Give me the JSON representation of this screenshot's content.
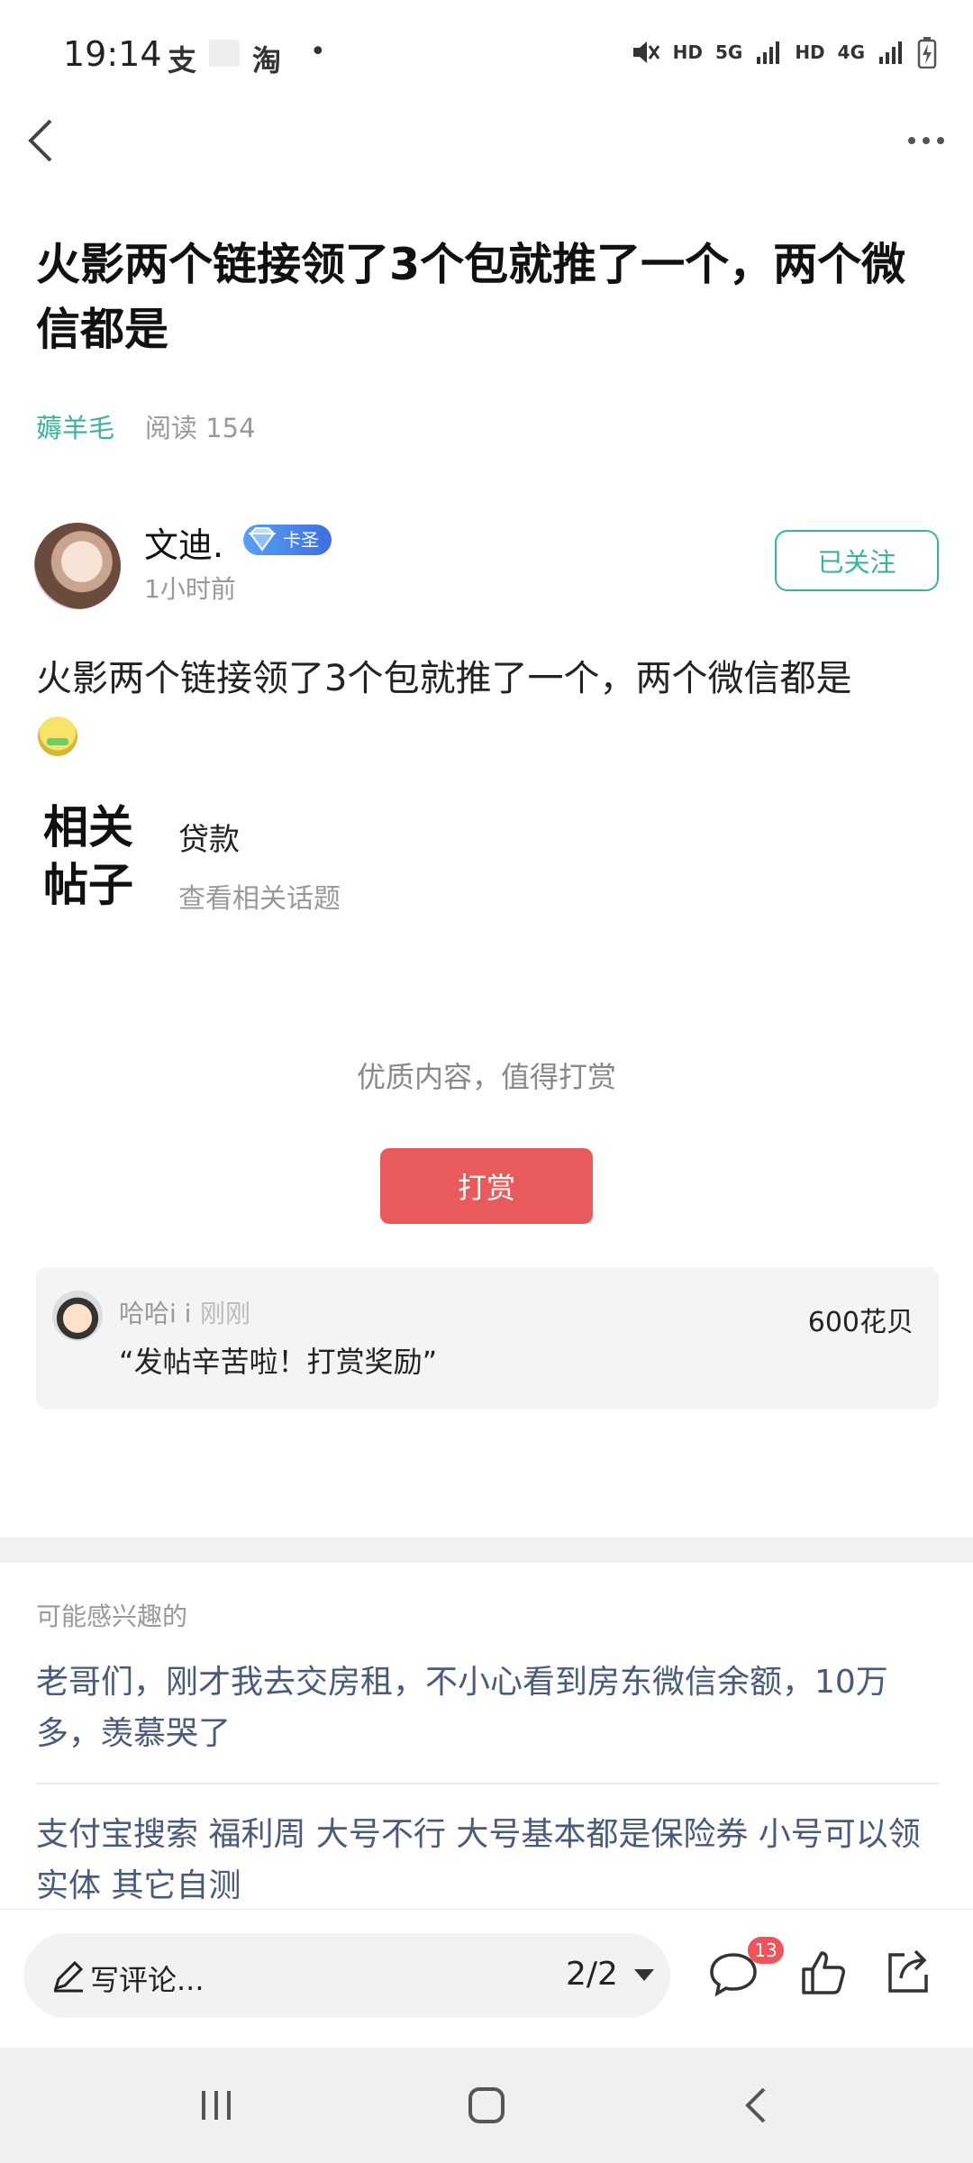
{
  "status_bar": {
    "time": "19:14",
    "app_icons": [
      "支",
      "淘"
    ],
    "dot": "•",
    "signal_text": [
      "HD",
      "5G",
      "HD",
      "4G"
    ]
  },
  "nav": {
    "back_icon": "chevron-left-icon",
    "more_icon": "more-dots-icon"
  },
  "post": {
    "title": "火影两个链接领了3个包就推了一个，两个微信都是",
    "category": "薅羊毛",
    "reads": "阅读 154",
    "author": {
      "name": "文迪.",
      "badge": "卡圣",
      "time": "1小时前",
      "follow_label": "已关注"
    },
    "body": "火影两个链接领了3个包就推了一个，两个微信都是"
  },
  "related": {
    "logo_line1": "相关",
    "logo_line2": "帖子",
    "title": "贷款",
    "subtitle": "查看相关话题"
  },
  "reward": {
    "prompt": "优质内容，值得打赏",
    "button_label": "打赏",
    "record": {
      "name": "哈哈i i",
      "time": "刚刚",
      "amount": "600花贝",
      "message": "“发帖辛苦啦！打赏奖励”"
    }
  },
  "recommend": {
    "heading": "可能感兴趣的",
    "items": [
      "老哥们，刚才我去交房租，不小心看到房东微信余额，10万多，羡慕哭了",
      "支付宝搜索 福利周 大号不行 大号基本都是保险券 小号可以领实体 其它自测"
    ]
  },
  "bottom_bar": {
    "comment_placeholder": "写评论...",
    "page_indicator": "2/2",
    "comment_count": "13"
  },
  "colors": {
    "accent_green": "#3bb39b",
    "reward_red": "#e85a5b",
    "link_blue": "#4a5a7d",
    "badge_red": "#f0545a"
  }
}
